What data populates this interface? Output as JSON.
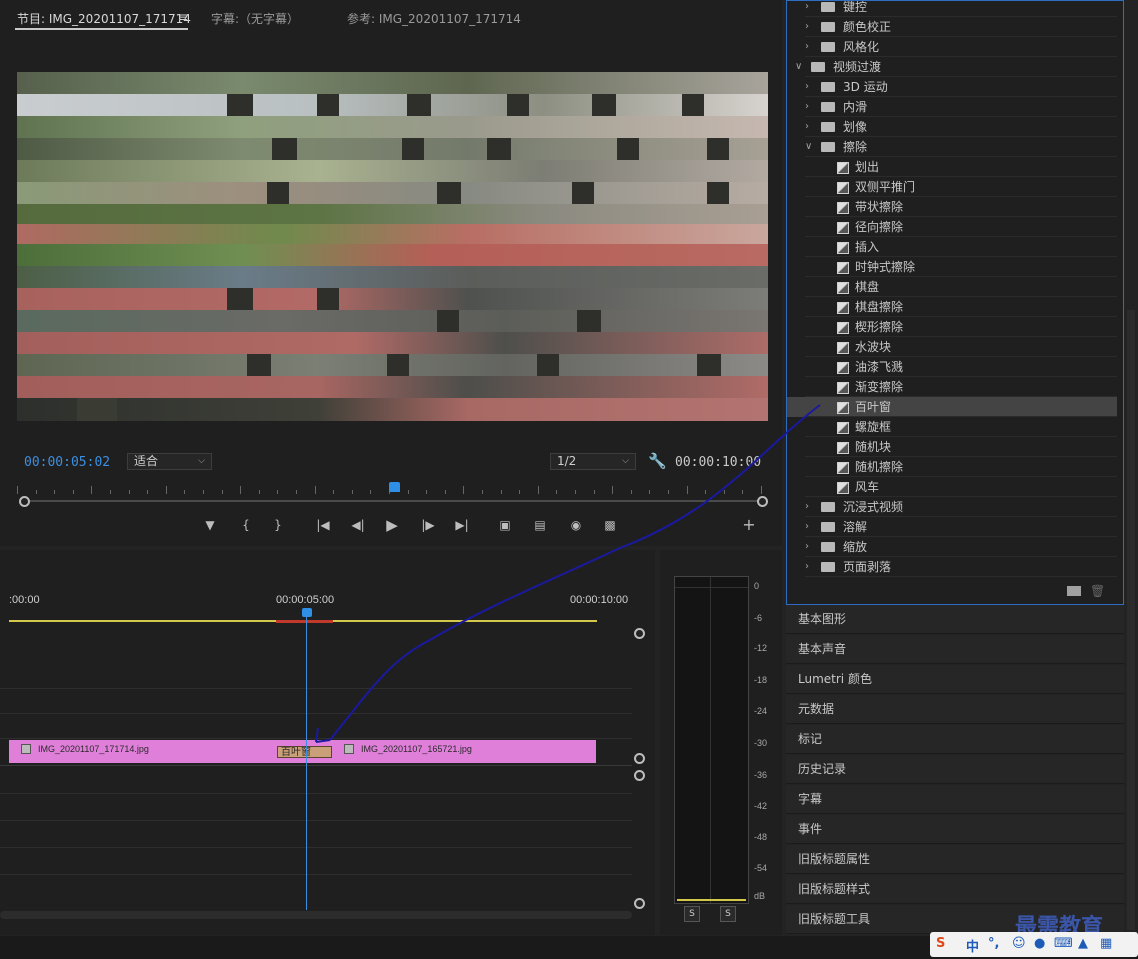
{
  "monitor": {
    "tabs": [
      "节目: IMG_20201107_171714",
      "≡",
      "字幕:（无字幕）",
      "参考: IMG_20201107_171714"
    ],
    "current_timecode": "00:00:05:02",
    "duration_timecode": "00:00:10:00",
    "fit_select": "适合",
    "resolution_select": "1/2",
    "playhead_fraction": 0.5
  },
  "timeline": {
    "times": [
      ":00:00",
      "00:00:05:00",
      "00:00:10:00"
    ],
    "clip_a": "IMG_20201107_171714.jpg",
    "clip_b": "IMG_20201107_165721.jpg",
    "transition": "百叶窗"
  },
  "meter": {
    "ticks": [
      "0",
      "-6",
      "-12",
      "-18",
      "-24",
      "-30",
      "-36",
      "-42",
      "-48",
      "-54",
      "dB"
    ],
    "solo": [
      "S",
      "S"
    ]
  },
  "effects": {
    "items": [
      {
        "label": "键控",
        "type": "folder",
        "expanded": false,
        "level": 1
      },
      {
        "label": "颜色校正",
        "type": "folder",
        "expanded": false,
        "level": 1
      },
      {
        "label": "风格化",
        "type": "folder",
        "expanded": false,
        "level": 1
      },
      {
        "label": "视频过渡",
        "type": "folder",
        "expanded": true,
        "level": 0
      },
      {
        "label": "3D 运动",
        "type": "folder",
        "expanded": false,
        "level": 1
      },
      {
        "label": "内滑",
        "type": "folder",
        "expanded": false,
        "level": 1
      },
      {
        "label": "划像",
        "type": "folder",
        "expanded": false,
        "level": 1
      },
      {
        "label": "擦除",
        "type": "folder",
        "expanded": true,
        "level": 1
      },
      {
        "label": "划出",
        "type": "effect",
        "level": 2
      },
      {
        "label": "双侧平推门",
        "type": "effect",
        "level": 2
      },
      {
        "label": "带状擦除",
        "type": "effect",
        "level": 2
      },
      {
        "label": "径向擦除",
        "type": "effect",
        "level": 2
      },
      {
        "label": "插入",
        "type": "effect",
        "level": 2
      },
      {
        "label": "时钟式擦除",
        "type": "effect",
        "level": 2
      },
      {
        "label": "棋盘",
        "type": "effect",
        "level": 2
      },
      {
        "label": "棋盘擦除",
        "type": "effect",
        "level": 2
      },
      {
        "label": "楔形擦除",
        "type": "effect",
        "level": 2
      },
      {
        "label": "水波块",
        "type": "effect",
        "level": 2
      },
      {
        "label": "油漆飞溅",
        "type": "effect",
        "level": 2
      },
      {
        "label": "渐变擦除",
        "type": "effect",
        "level": 2
      },
      {
        "label": "百叶窗",
        "type": "effect",
        "level": 2,
        "selected": true
      },
      {
        "label": "螺旋框",
        "type": "effect",
        "level": 2
      },
      {
        "label": "随机块",
        "type": "effect",
        "level": 2
      },
      {
        "label": "随机擦除",
        "type": "effect",
        "level": 2
      },
      {
        "label": "风车",
        "type": "effect",
        "level": 2
      },
      {
        "label": "沉浸式视频",
        "type": "folder",
        "expanded": false,
        "level": 1
      },
      {
        "label": "溶解",
        "type": "folder",
        "expanded": false,
        "level": 1
      },
      {
        "label": "缩放",
        "type": "folder",
        "expanded": false,
        "level": 1
      },
      {
        "label": "页面剥落",
        "type": "folder",
        "expanded": false,
        "level": 1
      }
    ]
  },
  "panels": [
    "基本图形",
    "基本声音",
    "Lumetri 颜色",
    "元数据",
    "标记",
    "历史记录",
    "字幕",
    "事件",
    "旧版标题属性",
    "旧版标题样式",
    "旧版标题工具"
  ],
  "watermark": "最需教育",
  "ime": {
    "logo": "S",
    "mode": "中",
    "punct": "°,"
  },
  "colors": {
    "accent": "#2f8ee6",
    "clip": "#e07fd9",
    "transition": "#c9a077",
    "annotation_arrow": "#1a1aa0"
  }
}
